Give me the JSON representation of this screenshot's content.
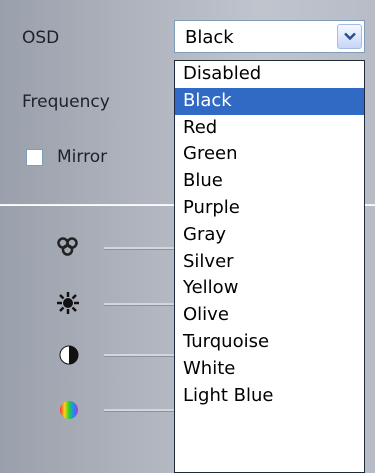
{
  "osd": {
    "label": "OSD",
    "selected": "Black",
    "options": [
      "Disabled",
      "Black",
      "Red",
      "Green",
      "Blue",
      "Purple",
      "Gray",
      "Silver",
      "Yellow",
      "Olive",
      "Turquoise",
      "White",
      "Light Blue"
    ],
    "selected_index": 1
  },
  "frequency": {
    "label": "Frequency"
  },
  "mirror": {
    "label": "Mirror",
    "checked": false
  },
  "sliders": [
    {
      "name": "saturation",
      "icon": "saturation-icon"
    },
    {
      "name": "brightness",
      "icon": "brightness-icon"
    },
    {
      "name": "contrast",
      "icon": "contrast-icon"
    },
    {
      "name": "hue",
      "icon": "hue-icon"
    }
  ],
  "colors": {
    "selection": "#316ac5",
    "field_border": "#7f9db9"
  }
}
